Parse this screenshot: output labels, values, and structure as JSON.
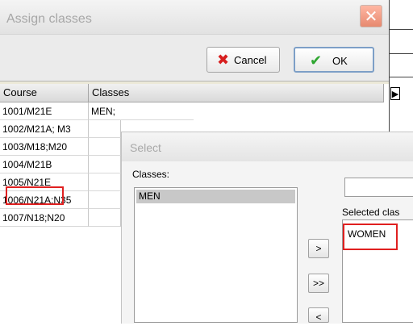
{
  "window": {
    "title": "Assign classes",
    "close_glyph": "✕"
  },
  "toolbar": {
    "cancel_label": "Cancel",
    "cancel_icon": "x-icon",
    "ok_label": "OK",
    "ok_icon": "checkmark-icon"
  },
  "grid": {
    "columns": [
      "Course",
      "Classes"
    ],
    "rows": [
      {
        "course": "1001/M21E",
        "classes": "MEN;"
      },
      {
        "course": "1002/M21A; M3",
        "classes": ""
      },
      {
        "course": "1003/M18;M20",
        "classes": ""
      },
      {
        "course": "1004/M21B",
        "classes": ""
      },
      {
        "course": "1005/N21E",
        "classes": ""
      },
      {
        "course": "1006/N21A;N35",
        "classes": ""
      },
      {
        "course": "1007/N18;N20",
        "classes": ""
      }
    ],
    "scroll_glyph": "▶"
  },
  "select_dialog": {
    "title": "Select",
    "classes_label": "Classes:",
    "classes_items": [
      "MEN"
    ],
    "selected_label": "Selected clas",
    "selected_items": [
      "WOMEN"
    ],
    "add_button": ">",
    "add_all_button": ">>",
    "remove_button": "<"
  },
  "colors": {
    "highlight": "#e02020",
    "cancel_icon": "#d71f1f",
    "ok_icon": "#2ea630"
  }
}
